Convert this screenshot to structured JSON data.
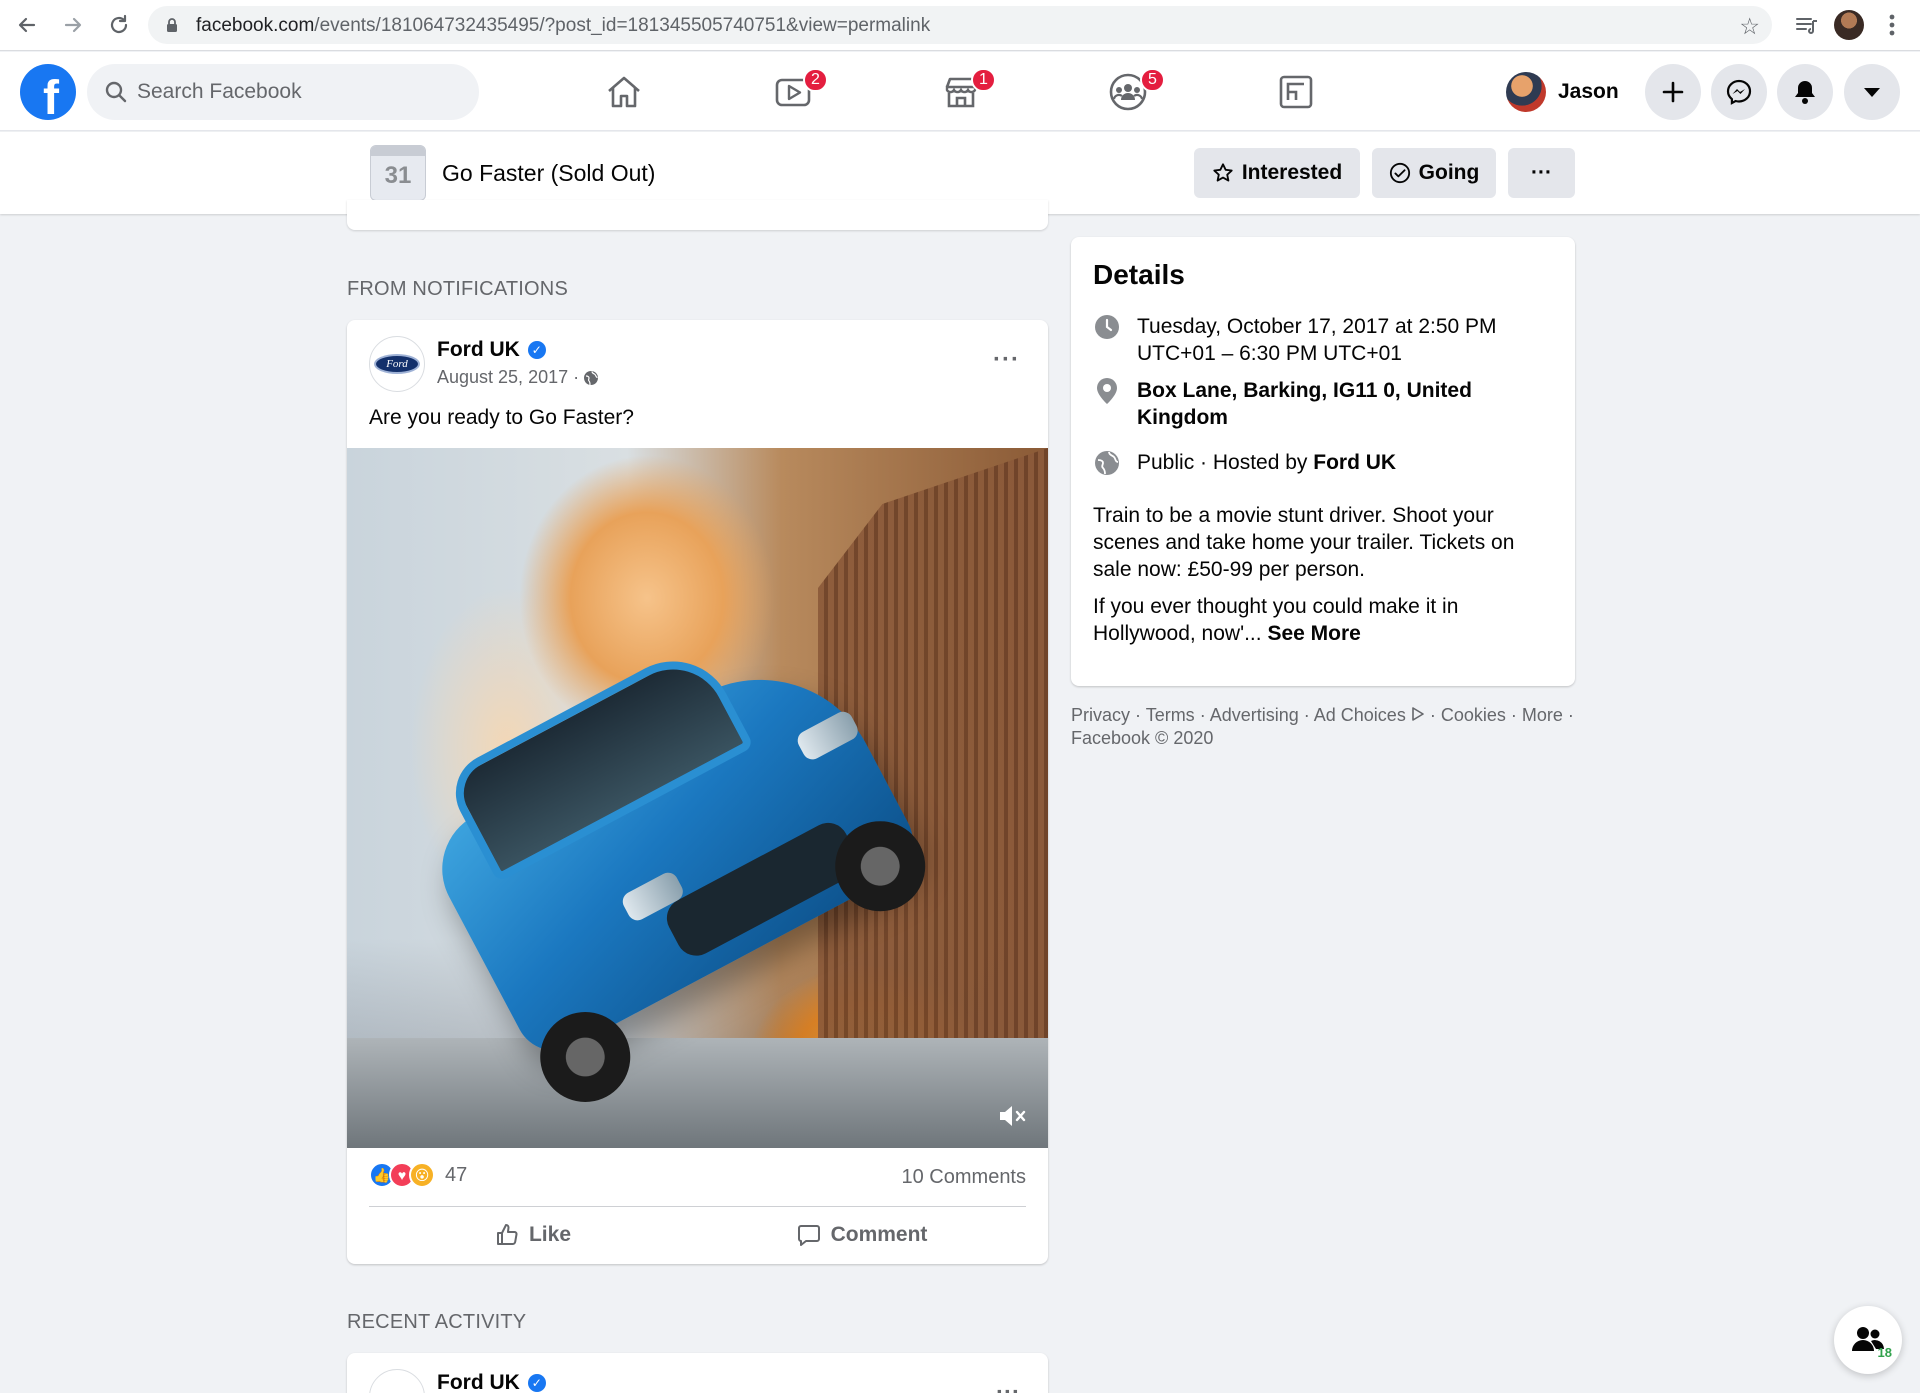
{
  "browser": {
    "url_host": "facebook.com",
    "url_path": "/events/181064732435495/?post_id=181345505740751&view=permalink"
  },
  "header": {
    "logo": "f",
    "search_placeholder": "Search Facebook",
    "tabs": [
      {
        "name": "home",
        "icon": "home-icon",
        "badge": ""
      },
      {
        "name": "watch",
        "icon": "video-icon",
        "badge": "2"
      },
      {
        "name": "marketplace",
        "icon": "store-icon",
        "badge": "1"
      },
      {
        "name": "groups",
        "icon": "groups-icon",
        "badge": "5"
      },
      {
        "name": "gaming",
        "icon": "gaming-icon",
        "badge": ""
      }
    ],
    "user_name": "Jason"
  },
  "event": {
    "calendar_day": "31",
    "title": "Go Faster (Sold Out)",
    "interested_label": "Interested",
    "going_label": "Going",
    "more_label": "···"
  },
  "feed": {
    "section_notifications": "FROM NOTIFICATIONS",
    "section_recent": "RECENT ACTIVITY",
    "post": {
      "logo_text": "Ford",
      "author": "Ford UK",
      "date": "August 25, 2017 ·",
      "text": "Are you ready to Go Faster?",
      "reaction_count": "47",
      "comments": "10 Comments",
      "like_label": "Like",
      "comment_label": "Comment"
    },
    "post2": {
      "author": "Ford UK"
    }
  },
  "details": {
    "title": "Details",
    "datetime": "Tuesday, October 17, 2017 at 2:50 PM UTC+01 – 6:30 PM UTC+01",
    "location": "Box Lane, Barking, IG11 0, United Kingdom",
    "privacy_prefix": "Public · Hosted by",
    "host": "Ford UK",
    "description_1": "Train to be a movie stunt driver. Shoot your scenes and take home your trailer. Tickets on sale now: £50-99 per person.",
    "description_2": "If you ever thought you could make it in Hollywood, now'...",
    "see_more": "See More"
  },
  "footer": {
    "links": [
      "Privacy",
      "Terms",
      "Advertising",
      "Ad Choices",
      "Cookies",
      "More"
    ],
    "copyright": "Facebook © 2020"
  },
  "contacts": {
    "count": "18"
  },
  "colors": {
    "brand": "#1877f2",
    "badge": "#e41e3f"
  }
}
